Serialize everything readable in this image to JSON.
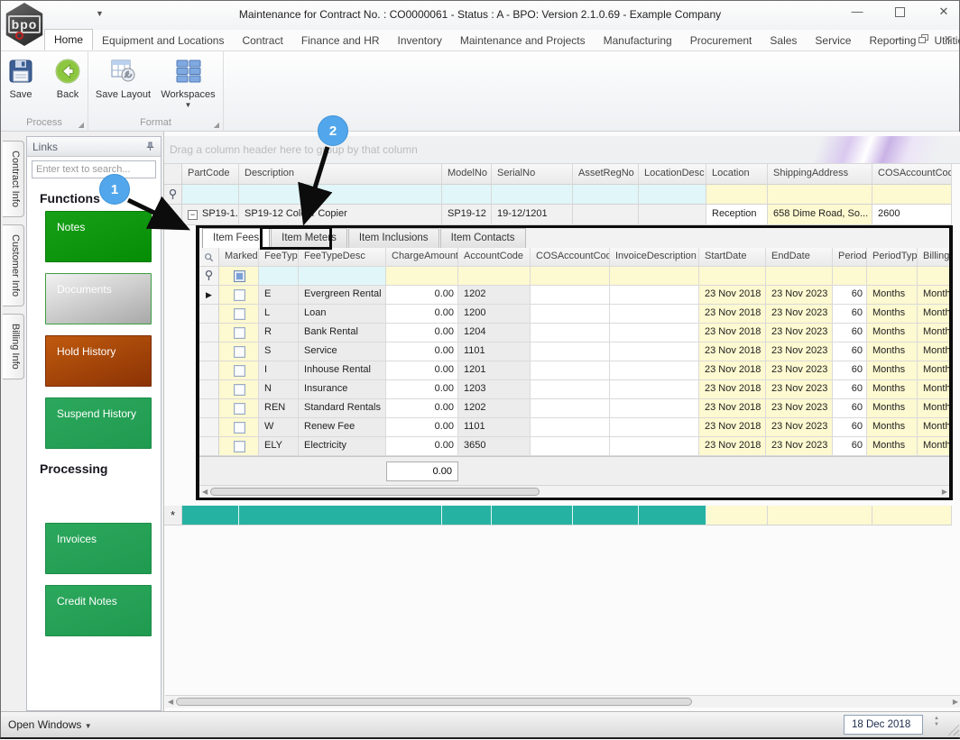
{
  "colors": {
    "teal_cell": "#26b2a2",
    "yellow_cell": "#fdf9d0",
    "cyan_cell": "#e1f6f8",
    "gray_cell": "#ececec",
    "callout_blue": "#52a7ec",
    "green_button": "#0f9d0f",
    "emerald_button": "#28a158",
    "rust_button": "#a84408"
  },
  "window": {
    "title": "Maintenance for Contract No. : CO0000061 - Status : A - BPO: Version 2.1.0.69 - Example Company"
  },
  "ribbon": {
    "tabs": [
      "Home",
      "Equipment and Locations",
      "Contract",
      "Finance and HR",
      "Inventory",
      "Maintenance and Projects",
      "Manufacturing",
      "Procurement",
      "Sales",
      "Service",
      "Reporting",
      "Utilities"
    ],
    "active_tab": "Home",
    "buttons": [
      {
        "label": "Save",
        "icon": "floppy-disk-icon"
      },
      {
        "label": "Back",
        "icon": "back-arrow-icon"
      },
      {
        "label": "Save Layout",
        "icon": "table-wrench-icon"
      },
      {
        "label": "Workspaces",
        "icon": "tile-grid-icon",
        "has_dropdown": true
      }
    ],
    "groups": [
      {
        "label": "Process"
      },
      {
        "label": "Format"
      }
    ]
  },
  "side_tabs": [
    "Contract Info",
    "Customer Info",
    "Billing Info"
  ],
  "sidebar": {
    "panel_title": "Links",
    "search_placeholder": "Enter text to search...",
    "sections": [
      {
        "heading": "Functions",
        "buttons": [
          {
            "label": "Notes",
            "style": "green"
          },
          {
            "label": "Documents",
            "style": "silver"
          },
          {
            "label": "Hold History",
            "style": "rust"
          },
          {
            "label": "Suspend History",
            "style": "emerald"
          }
        ]
      },
      {
        "heading": "Processing",
        "buttons": [
          {
            "label": "Invoices",
            "style": "emerald"
          },
          {
            "label": "Credit Notes",
            "style": "emerald"
          }
        ]
      }
    ]
  },
  "grid": {
    "group_hint": "Drag a column header here to group by that column",
    "columns": [
      "PartCode",
      "Description",
      "ModelNo",
      "SerialNo",
      "AssetRegNo",
      "LocationDesc",
      "Location",
      "ShippingAddress",
      "COSAccountCode"
    ],
    "row": [
      "SP19-1...",
      "SP19-12 Colour Copier",
      "SP19-12",
      "19-12/1201",
      "",
      "",
      "Reception",
      "658 Dime Road, So...",
      "2600"
    ]
  },
  "subgrid": {
    "tabs": [
      "Item Fees",
      "Item Meters",
      "Item Inclusions",
      "Item Contacts"
    ],
    "active_tab": "Item Fees",
    "columns": [
      "Marked",
      "FeeType",
      "FeeTypeDesc",
      "ChargeAmount",
      "AccountCode",
      "COSAccountCode",
      "InvoiceDescription",
      "StartDate",
      "EndDate",
      "Period",
      "PeriodType",
      "BillingCycle"
    ],
    "rows": [
      [
        "E",
        "Evergreen Rental",
        "0.00",
        "1202",
        "",
        "",
        "23 Nov 2018",
        "23 Nov 2023",
        "60",
        "Months",
        "Monthly"
      ],
      [
        "L",
        "Loan",
        "0.00",
        "1200",
        "",
        "",
        "23 Nov 2018",
        "23 Nov 2023",
        "60",
        "Months",
        "Monthly"
      ],
      [
        "R",
        "Bank Rental",
        "0.00",
        "1204",
        "",
        "",
        "23 Nov 2018",
        "23 Nov 2023",
        "60",
        "Months",
        "Monthly"
      ],
      [
        "S",
        "Service",
        "0.00",
        "1101",
        "",
        "",
        "23 Nov 2018",
        "23 Nov 2023",
        "60",
        "Months",
        "Monthly"
      ],
      [
        "I",
        "Inhouse Rental",
        "0.00",
        "1201",
        "",
        "",
        "23 Nov 2018",
        "23 Nov 2023",
        "60",
        "Months",
        "Monthly"
      ],
      [
        "N",
        "Insurance",
        "0.00",
        "1203",
        "",
        "",
        "23 Nov 2018",
        "23 Nov 2023",
        "60",
        "Months",
        "Monthly"
      ],
      [
        "REN",
        "Standard Rentals",
        "0.00",
        "1202",
        "",
        "",
        "23 Nov 2018",
        "23 Nov 2023",
        "60",
        "Months",
        "Monthly"
      ],
      [
        "W",
        "Renew Fee",
        "0.00",
        "1101",
        "",
        "",
        "23 Nov 2018",
        "23 Nov 2023",
        "60",
        "Months",
        "Monthly"
      ],
      [
        "ELY",
        "Electricity",
        "0.00",
        "3650",
        "",
        "",
        "23 Nov 2018",
        "23 Nov 2023",
        "60",
        "Months",
        "Monthly"
      ]
    ],
    "summary_total": "0.00"
  },
  "statusbar": {
    "open_windows_label": "Open Windows",
    "date_value": "18 Dec 2018"
  },
  "annotations": {
    "callout_1": "1",
    "callout_2": "2"
  }
}
